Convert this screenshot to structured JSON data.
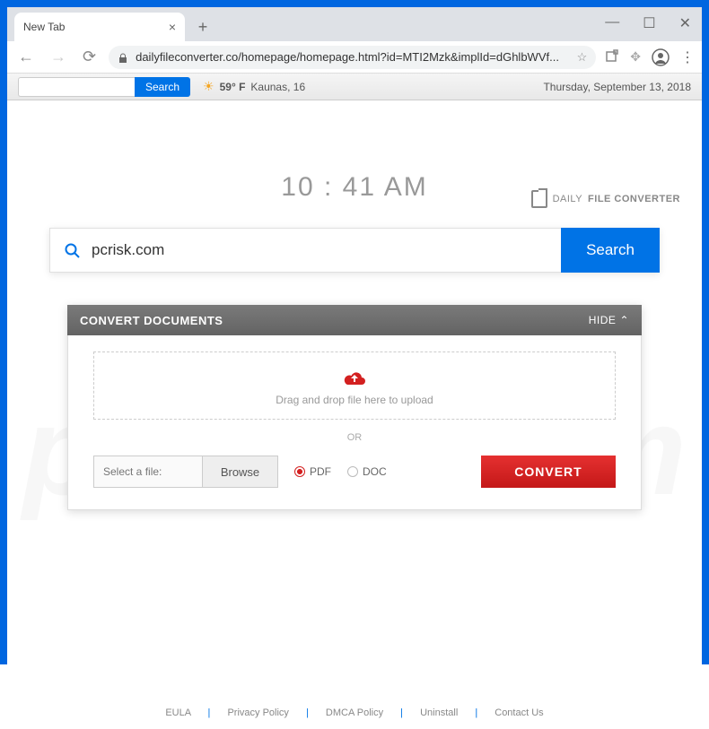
{
  "window": {
    "tab_title": "New Tab"
  },
  "addressbar": {
    "url": "dailyfileconverter.co/homepage/homepage.html?id=MTI2Mzk&implId=dGhlbWVf..."
  },
  "toolbar": {
    "mini_search_btn": "Search",
    "weather_temp": "59° F",
    "weather_loc": "Kaunas, 16",
    "date": "Thursday, September 13, 2018"
  },
  "brand": {
    "name_prefix": "DAILY ",
    "name_bold": "FILE CONVERTER"
  },
  "clock": "10 : 41 AM",
  "search": {
    "value": "pcrisk.com",
    "button": "Search"
  },
  "convert": {
    "header": "CONVERT DOCUMENTS",
    "hide": "HIDE",
    "drop_text": "Drag and drop file here to upload",
    "or": "OR",
    "file_placeholder": "Select a file:",
    "browse": "Browse",
    "opt_pdf": "PDF",
    "opt_doc": "DOC",
    "button": "CONVERT"
  },
  "footer": {
    "links": [
      "EULA",
      "Privacy Policy",
      "DMCA Policy",
      "Uninstall",
      "Contact Us"
    ]
  }
}
